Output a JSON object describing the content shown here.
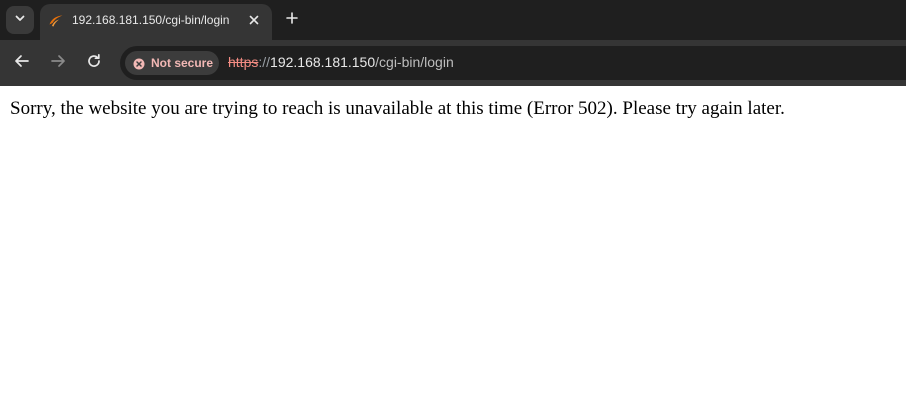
{
  "browser": {
    "tab": {
      "title": "192.168.181.150/cgi-bin/login",
      "favicon_icon": "orange-swoosh-icon"
    },
    "toolbar": {
      "security_label": "Not secure",
      "url": {
        "scheme": "https",
        "separator": "://",
        "host": "192.168.181.150",
        "path": "/cgi-bin/login"
      }
    },
    "colors": {
      "tab_strip": "#1f1f1f",
      "toolbar": "#353535",
      "omnibox": "#1f1f1f",
      "not_secure_text": "#f2b8b5",
      "scheme_strikethrough": "#f28b82",
      "favicon": "#e8710a"
    }
  },
  "page": {
    "message": "Sorry, the website you are trying to reach is unavailable at this time (Error 502). Please try again later."
  }
}
